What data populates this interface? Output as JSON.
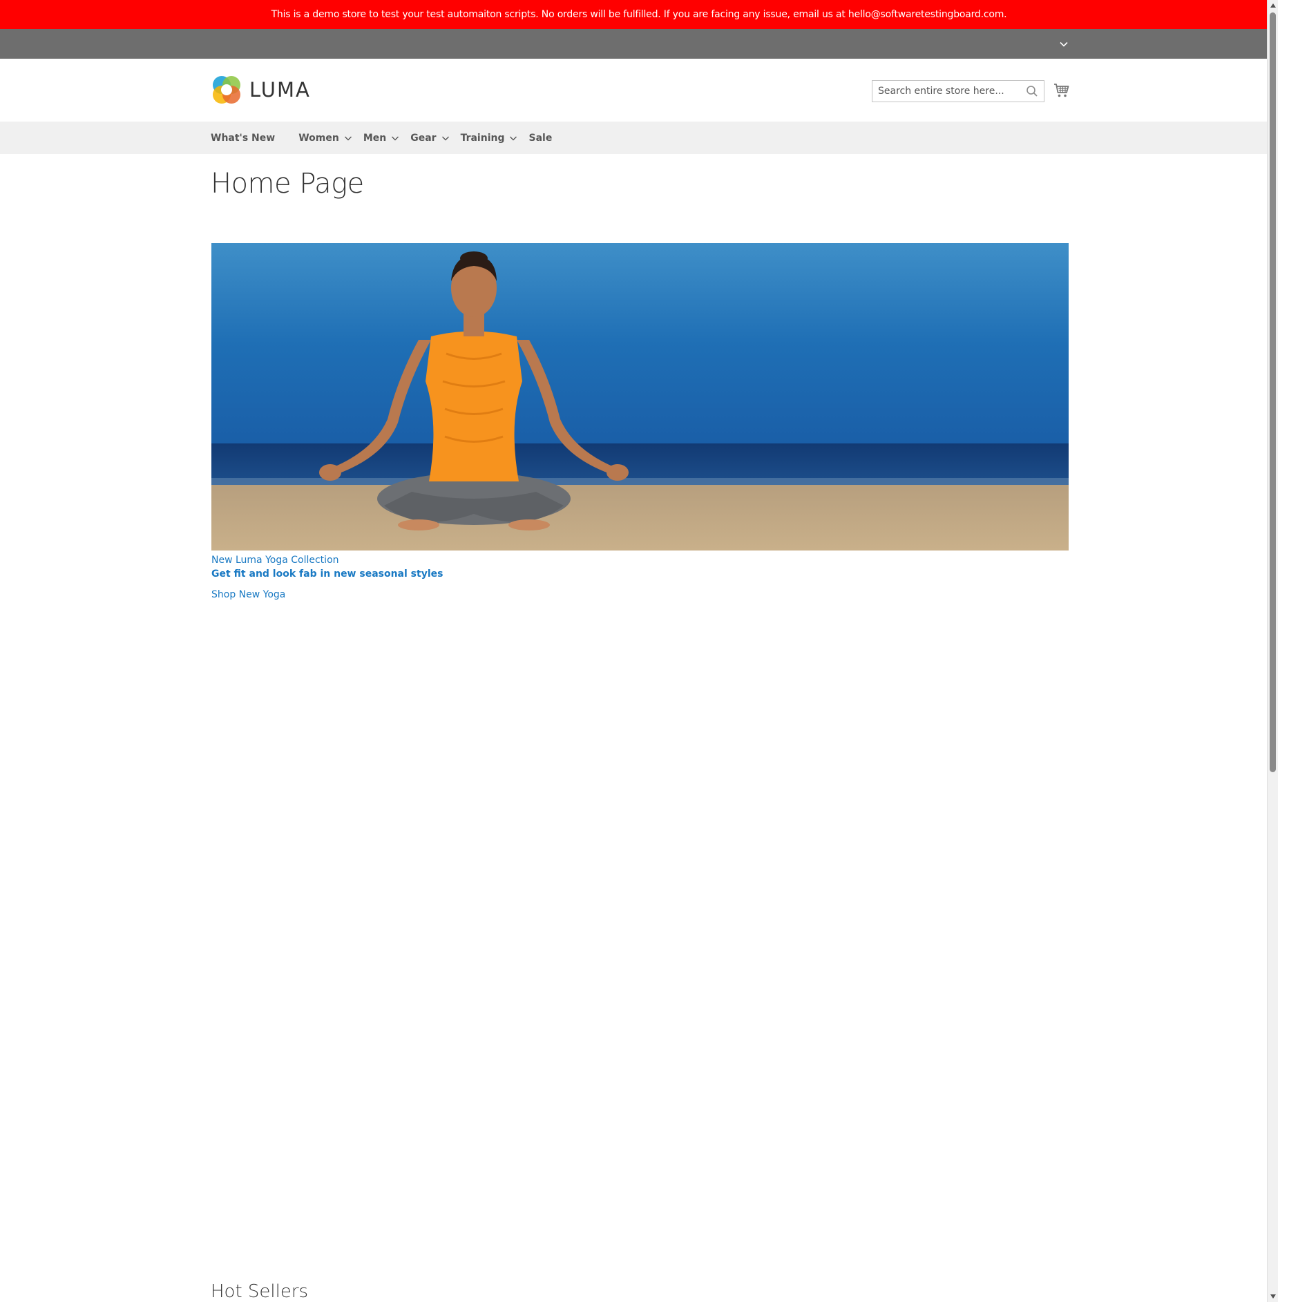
{
  "demo_notice": {
    "text": "This is a demo store to test your test automaiton scripts. No orders will be fulfilled. If you are facing any issue, email us at hello@softwaretestingboard.com.",
    "color": "#ff0000"
  },
  "panel_header": {
    "switcher_icon": "chevron-down-icon",
    "color": "#6e6e6e"
  },
  "header": {
    "logo_text": "LUMA",
    "search": {
      "placeholder": "Search entire store here...",
      "value": ""
    },
    "search_icon": "search-icon",
    "cart_icon": "cart-icon"
  },
  "nav": {
    "items": [
      {
        "label": "What's New",
        "has_submenu": false
      },
      {
        "label": "Women",
        "has_submenu": true
      },
      {
        "label": "Men",
        "has_submenu": true
      },
      {
        "label": "Gear",
        "has_submenu": true
      },
      {
        "label": "Training",
        "has_submenu": true
      },
      {
        "label": "Sale",
        "has_submenu": false
      }
    ]
  },
  "main": {
    "page_title": "Home Page",
    "hero": {
      "subtitle": "New Luma Yoga Collection",
      "title": "Get fit and look fab in new seasonal styles",
      "link": "Shop New Yoga"
    },
    "section_title": "Hot Sellers"
  },
  "colors": {
    "link": "#1979c3",
    "nav_bg": "#f0f0f0"
  }
}
